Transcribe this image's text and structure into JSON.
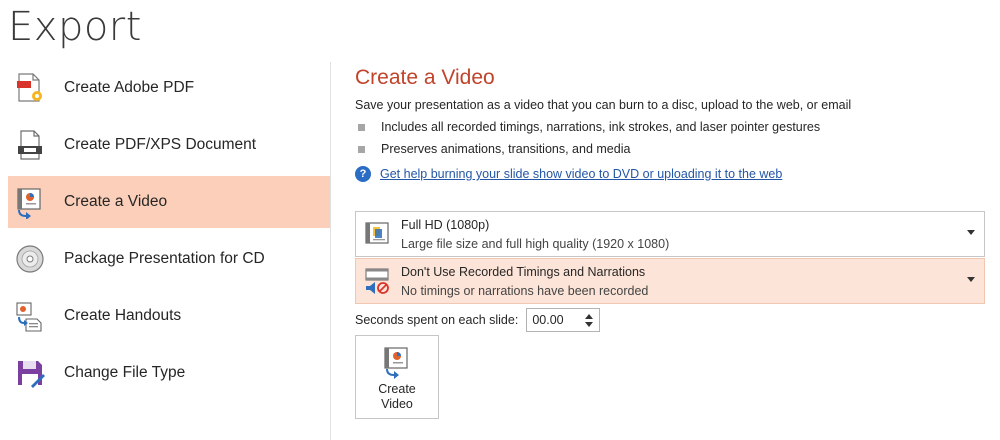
{
  "page": {
    "title": "Export"
  },
  "nav": {
    "items": [
      {
        "label": "Create Adobe PDF",
        "icon": "adobe-pdf-icon"
      },
      {
        "label": "Create PDF/XPS Document",
        "icon": "pdf-xps-icon"
      },
      {
        "label": "Create a Video",
        "icon": "video-icon",
        "selected": true
      },
      {
        "label": "Package Presentation for CD",
        "icon": "cd-icon"
      },
      {
        "label": "Create Handouts",
        "icon": "handouts-icon"
      },
      {
        "label": "Change File Type",
        "icon": "save-file-icon"
      }
    ]
  },
  "main": {
    "title": "Create a Video",
    "description": "Save your presentation as a video that you can burn to a disc, upload to the web, or email",
    "bullets": [
      "Includes all recorded timings, narrations, ink strokes, and laser pointer gestures",
      "Preserves animations, transitions, and media"
    ],
    "help_link": "Get help burning your slide show video to DVD or uploading it to the web",
    "quality_dropdown": {
      "title": "Full HD (1080p)",
      "subtitle": "Large file size and full high quality (1920 x 1080)"
    },
    "timings_dropdown": {
      "title": "Don't Use Recorded Timings and Narrations",
      "subtitle": "No timings or narrations have been recorded"
    },
    "seconds": {
      "label": "Seconds spent on each slide:",
      "value": "00.00"
    },
    "create_button": {
      "label": "Create Video"
    }
  },
  "colors": {
    "accent": "#c0432a",
    "selected": "#fbcfb9",
    "highlight": "#fde4d8",
    "link": "#2456a6"
  }
}
